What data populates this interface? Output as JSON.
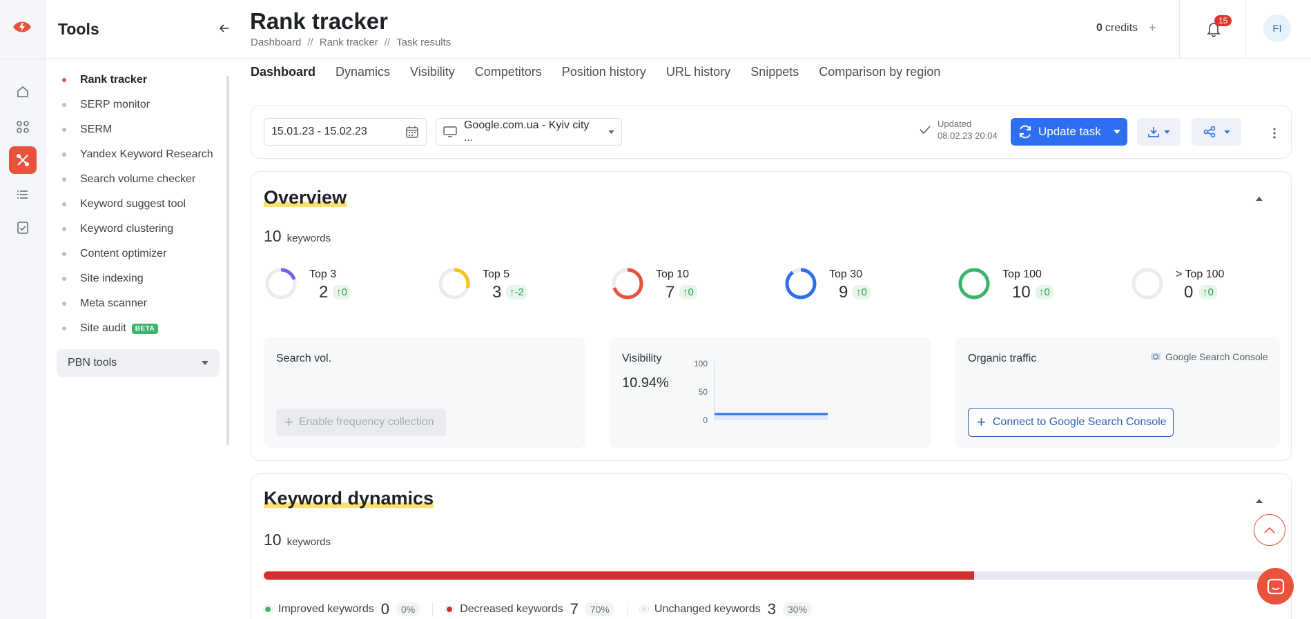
{
  "tools_panel": {
    "title": "Tools",
    "items": [
      {
        "label": "Rank tracker",
        "active": true
      },
      {
        "label": "SERP monitor"
      },
      {
        "label": "SERM"
      },
      {
        "label": "Yandex Keyword Research"
      },
      {
        "label": "Search volume checker"
      },
      {
        "label": "Keyword suggest tool"
      },
      {
        "label": "Keyword clustering"
      },
      {
        "label": "Content optimizer"
      },
      {
        "label": "Site indexing"
      },
      {
        "label": "Meta scanner"
      },
      {
        "label": "Site audit"
      }
    ],
    "beta_badge": "BETA",
    "pbn_label": "PBN tools"
  },
  "header": {
    "title": "Rank tracker",
    "breadcrumb": [
      "Dashboard",
      "Rank tracker",
      "Task results"
    ],
    "breadcrumb_sep": "//",
    "credits_value": "0",
    "credits_label": "credits",
    "notifications_count": "15",
    "avatar_initials": "FI"
  },
  "tabs": [
    "Dashboard",
    "Dynamics",
    "Visibility",
    "Competitors",
    "Position history",
    "URL history",
    "Snippets",
    "Comparison by region"
  ],
  "toolbar": {
    "date_range": "15.01.23 - 15.02.23",
    "search_engine": "Google.com.ua - Kyiv city ...",
    "updated_label": "Updated",
    "updated_time": "08.02.23 20:04",
    "update_button": "Update task"
  },
  "overview": {
    "title": "Overview",
    "keyword_count": "10",
    "keyword_label": "keywords",
    "tops": [
      {
        "label": "Top 3",
        "value": "2",
        "delta": "0",
        "fraction": 0.2,
        "color": "#7b5cf0"
      },
      {
        "label": "Top 5",
        "value": "3",
        "delta": "-2",
        "fraction": 0.3,
        "color": "#f5c518"
      },
      {
        "label": "Top 10",
        "value": "7",
        "delta": "0",
        "fraction": 0.7,
        "color": "#e9523c"
      },
      {
        "label": "Top 30",
        "value": "9",
        "delta": "0",
        "fraction": 0.9,
        "color": "#2e6ff1"
      },
      {
        "label": "Top 100",
        "value": "10",
        "delta": "0",
        "fraction": 1.0,
        "color": "#3bb56c"
      },
      {
        "label": "> Top 100",
        "value": "0",
        "delta": "0",
        "fraction": 0.0,
        "color": "#cfd4da"
      }
    ],
    "search_vol": {
      "title": "Search vol.",
      "button": "Enable frequency collection"
    },
    "visibility": {
      "title": "Visibility",
      "value": "10.94%"
    },
    "organic_traffic": {
      "title": "Organic traffic",
      "source_label": "Google Search Console",
      "button": "Connect to Google Search Console"
    }
  },
  "chart_data": {
    "type": "area",
    "title": "",
    "xlabel": "",
    "ylabel": "",
    "ylim": [
      0,
      100
    ],
    "yticks": [
      "100",
      "50",
      "0"
    ],
    "series": [
      {
        "values": [
          10.94,
          10.94,
          10.94,
          10.94,
          10.94,
          10.94,
          10.94,
          10.94
        ]
      }
    ],
    "color": "#2e6ff1"
  },
  "keyword_dynamics": {
    "title": "Keyword dynamics",
    "keyword_count": "10",
    "keyword_label": "keywords",
    "decreased_share": 0.7,
    "legend": [
      {
        "label": "Improved keywords",
        "count": "0",
        "pct": "0%",
        "color": "#3bb56c"
      },
      {
        "label": "Decreased keywords",
        "count": "7",
        "pct": "70%",
        "color": "#d32f2f"
      },
      {
        "label": "Unchanged keywords",
        "count": "3",
        "pct": "30%",
        "color": "#e4e7ec"
      }
    ]
  },
  "colors": {
    "accent": "#e9523c",
    "primary": "#2e6ff1",
    "highlight": "#ffd84d"
  }
}
